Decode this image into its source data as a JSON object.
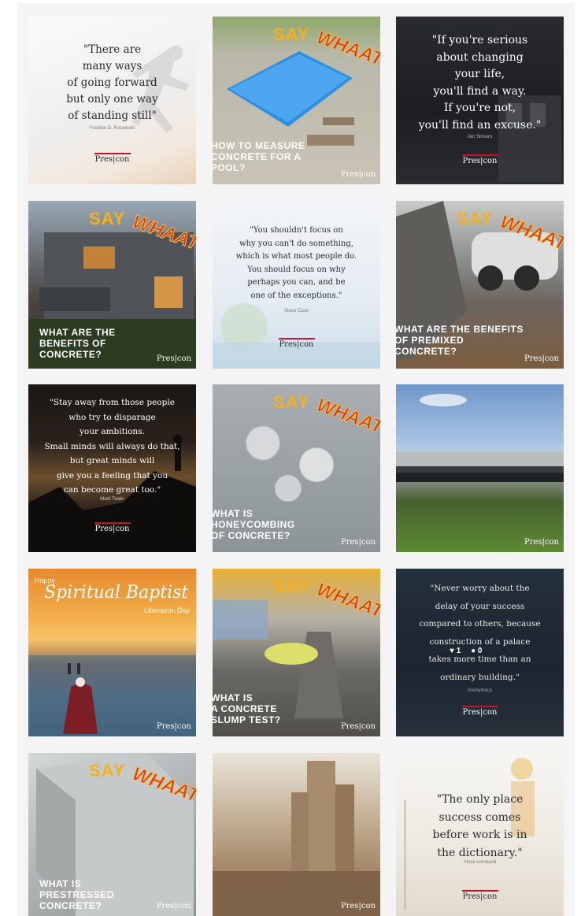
{
  "brand": {
    "logo": "Pres|con",
    "accent": "#c8102e"
  },
  "badge": {
    "part1": "SAY",
    "part2": "WHAAT!"
  },
  "posts": {
    "p1": {
      "quote": "\"There are\nmany ways\nof going forward\nbut only one way\nof standing still\"",
      "author": "Franklin D. Roosevelt",
      "logo": "Pres|con"
    },
    "p2": {
      "caption": "HOW TO MEASURE\nCONCRETE FOR A\nPOOL?",
      "logo": "Pres|con"
    },
    "p3": {
      "quote": "\"If you're serious\nabout changing\nyour life,\nyou'll find a way.\nIf you're not,\nyou'll find an excuse.\"",
      "author": "Jen Sincero",
      "logo": "Pres|con"
    },
    "p4": {
      "caption": "WHAT ARE THE\nBENEFITS OF\nCONCRETE?",
      "logo": "Pres|con"
    },
    "p5": {
      "quote": "\"You shouldn't focus on\nwhy you can't do something,\nwhich is what most people do.\nYou should focus on why\nperhaps you can, and be\none of the exceptions.\"",
      "author": "Steve Case",
      "logo": "Pres|con"
    },
    "p6": {
      "caption": "WHAT ARE THE BENEFITS\nOF PREMIXED\nCONCRETE?",
      "logo": "Pres|con"
    },
    "p7": {
      "quote": "\"Stay away from those people\nwho try to disparage\nyour ambitions.\nSmall minds will always do that,\nbut great minds will\ngive you a feeling that you\ncan become great too.\"",
      "author": "Mark Twain",
      "logo": "Pres|con"
    },
    "p8": {
      "caption": "WHAT IS\nHONEYCOMBING\nOF CONCRETE?",
      "logo": "Pres|con"
    },
    "p9": {
      "logo": "Pres|con"
    },
    "p10": {
      "happy": "Happy",
      "title": "Spiritual Baptist",
      "subtitle": "Liberation Day",
      "logo": "Pres|con"
    },
    "p11": {
      "caption": "WHAT IS\nA CONCRETE\nSLUMP TEST?",
      "logo": "Pres|con"
    },
    "p12": {
      "quote": "\"Never worry about the\ndelay of your success\ncompared to others, because\nconstruction of a palace\ntakes more time than an\nordinary building.\"",
      "author": "Anonymous",
      "logo": "Pres|con",
      "likes": "1",
      "comments": "0"
    },
    "p13": {
      "caption": "WHAT IS\nPRESTRESSED\nCONCRETE?",
      "logo": "Pres|con"
    },
    "p14": {
      "logo": "Pres|con"
    },
    "p15": {
      "quote": "\"The only place\nsuccess comes\nbefore work is in\nthe dictionary.\"",
      "author": "Vince Lombardi",
      "logo": "Pres|con"
    }
  }
}
